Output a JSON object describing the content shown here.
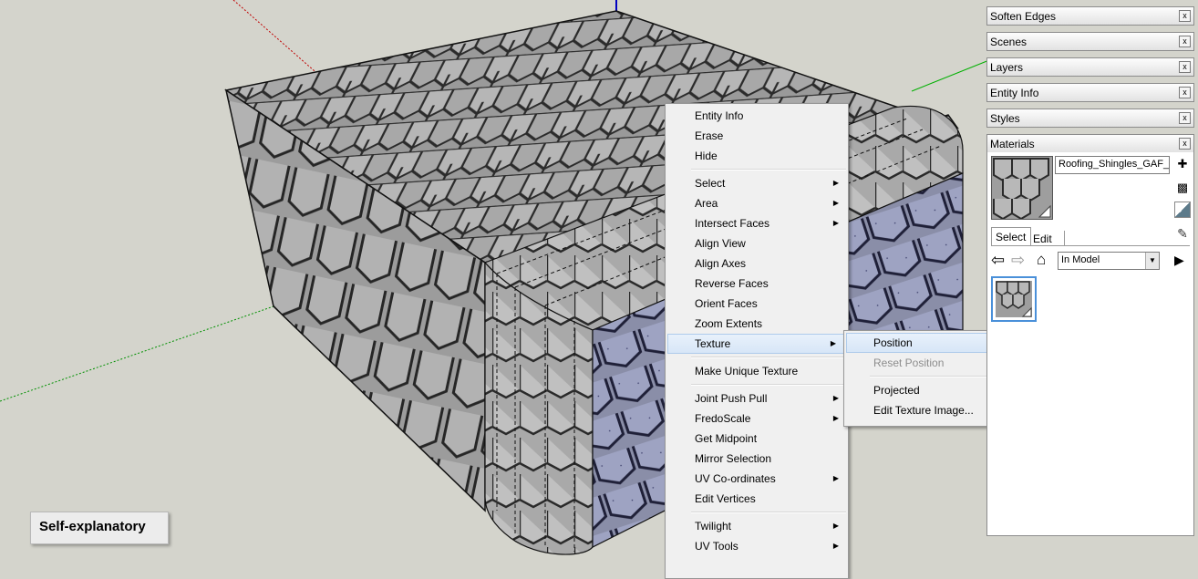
{
  "viewport": {
    "caption": "Self-explanatory"
  },
  "context_menu": {
    "items": [
      {
        "label": "Entity Info",
        "submenu": false
      },
      {
        "label": "Erase",
        "submenu": false
      },
      {
        "label": "Hide",
        "submenu": false
      },
      {
        "separator": true
      },
      {
        "label": "Select",
        "submenu": true
      },
      {
        "label": "Area",
        "submenu": true
      },
      {
        "label": "Intersect Faces",
        "submenu": true
      },
      {
        "label": "Align View",
        "submenu": false
      },
      {
        "label": "Align Axes",
        "submenu": false
      },
      {
        "label": "Reverse Faces",
        "submenu": false
      },
      {
        "label": "Orient Faces",
        "submenu": false
      },
      {
        "label": "Zoom Extents",
        "submenu": false
      },
      {
        "label": "Texture",
        "submenu": true,
        "highlighted": true
      },
      {
        "separator": true
      },
      {
        "label": "Make Unique Texture",
        "submenu": false
      },
      {
        "separator": true
      },
      {
        "label": "Joint Push Pull",
        "submenu": true
      },
      {
        "label": "FredoScale",
        "submenu": true
      },
      {
        "label": "Get Midpoint",
        "submenu": false
      },
      {
        "label": "Mirror Selection",
        "submenu": false
      },
      {
        "label": "UV Co-ordinates",
        "submenu": true
      },
      {
        "label": "Edit Vertices",
        "submenu": false
      },
      {
        "separator": true
      },
      {
        "label": "Twilight",
        "submenu": true
      },
      {
        "label": "UV Tools",
        "submenu": true
      }
    ]
  },
  "texture_submenu": {
    "items": [
      {
        "label": "Position",
        "highlighted": true
      },
      {
        "label": "Reset Position",
        "disabled": true
      },
      {
        "separator": true
      },
      {
        "label": "Projected"
      },
      {
        "label": "Edit Texture Image..."
      }
    ]
  },
  "tray": {
    "panels": [
      "Soften Edges",
      "Scenes",
      "Layers",
      "Entity Info",
      "Styles",
      "Materials"
    ],
    "close_glyph": "x"
  },
  "materials": {
    "name_value": "Roofing_Shingles_GAF_E",
    "tab_select": "Select",
    "tab_edit": "Edit",
    "collection": "In Model"
  },
  "colors": {
    "arrow": "#e01010",
    "highlight": "#d7e6f7",
    "axis_red": "#c00000",
    "axis_green": "#00a000",
    "axis_blue": "#0000c0"
  }
}
